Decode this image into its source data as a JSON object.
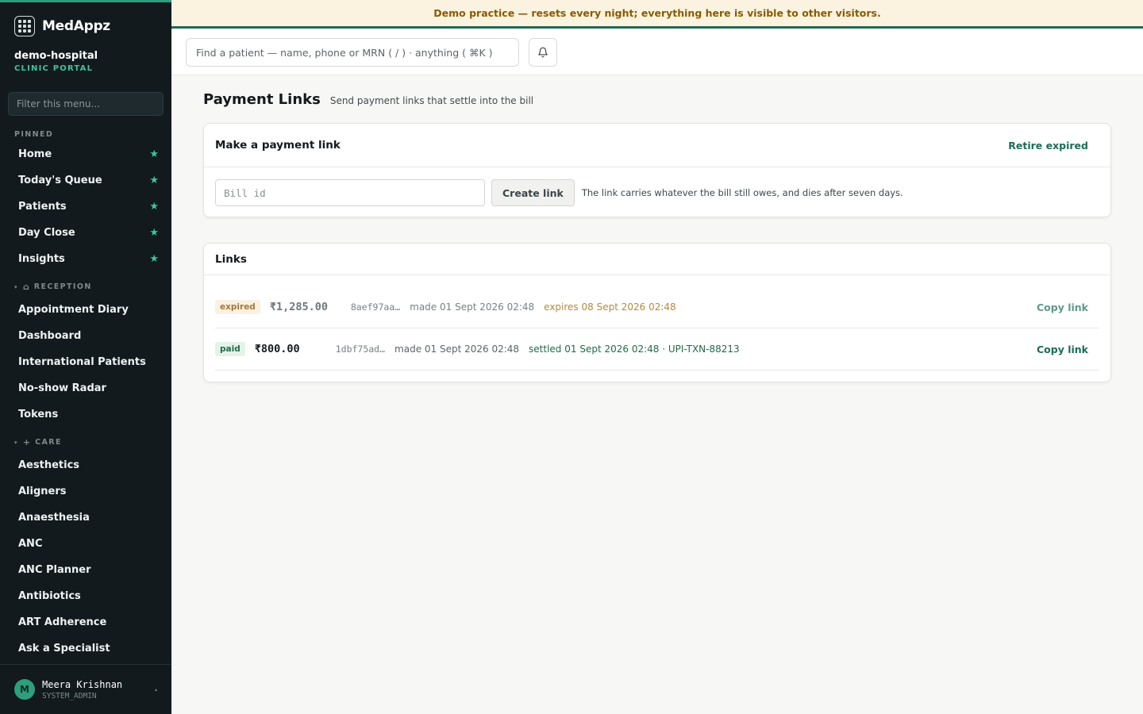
{
  "brand": {
    "name": "MedAppz"
  },
  "org": {
    "name": "demo-hospital",
    "subtitle": "CLINIC PORTAL"
  },
  "menu_filter": {
    "placeholder": "Filter this menu..."
  },
  "sidebar": {
    "pinned_label": "PINNED",
    "pinned": [
      {
        "label": "Home",
        "icon": "star-icon"
      },
      {
        "label": "Today's Queue",
        "icon": "star-icon"
      },
      {
        "label": "Patients",
        "icon": "star-icon"
      },
      {
        "label": "Day Close",
        "icon": "star-icon"
      },
      {
        "label": "Insights",
        "icon": "star-icon"
      }
    ],
    "reception": {
      "label": "RECEPTION",
      "icon": "home-icon",
      "items": [
        "Appointment Diary",
        "Dashboard",
        "International Patients",
        "No-show Radar",
        "Tokens"
      ]
    },
    "care": {
      "label": "CARE",
      "icon": "plus-icon",
      "items": [
        "Aesthetics",
        "Aligners",
        "Anaesthesia",
        "ANC",
        "ANC Planner",
        "Antibiotics",
        "ART Adherence",
        "Ask a Specialist"
      ]
    }
  },
  "user": {
    "initial": "M",
    "name": "Meera Krishnan",
    "role": "SYSTEM_ADMIN"
  },
  "banner": {
    "text": "Demo practice — resets every night; everything here is visible to other visitors."
  },
  "search": {
    "placeholder": "Find a patient — name, phone or MRN ( / ) · anything ( ⌘K )"
  },
  "page": {
    "title": "Payment Links",
    "subtitle": "Send payment links that settle into the bill"
  },
  "make_card": {
    "title": "Make a payment link",
    "retire_label": "Retire expired",
    "bill_placeholder": "Bill id",
    "create_label": "Create link",
    "hint": "The link carries whatever the bill still owes, and dies after seven days."
  },
  "links_card": {
    "title": "Links",
    "rows": [
      {
        "status": "expired",
        "amount": "₹1,285.00",
        "ref": "8aef97aa…",
        "made": "made 01 Sept 2026 02:48",
        "detail": "expires 08 Sept 2026 02:48",
        "copy": "Copy link"
      },
      {
        "status": "paid",
        "amount": "₹800.00",
        "ref": "1dbf75ad…",
        "made": "made 01 Sept 2026 02:48",
        "detail": "settled 01 Sept 2026 02:48 · UPI-TXN-88213",
        "copy": "Copy link"
      }
    ]
  },
  "colors": {
    "accent": "#2e9e7c",
    "sidebar_bg": "#121a1d",
    "banner_bg": "#fbf3df",
    "banner_text": "#8a5a00",
    "link_green": "#1f6b55",
    "expired": "#b38a3c"
  }
}
